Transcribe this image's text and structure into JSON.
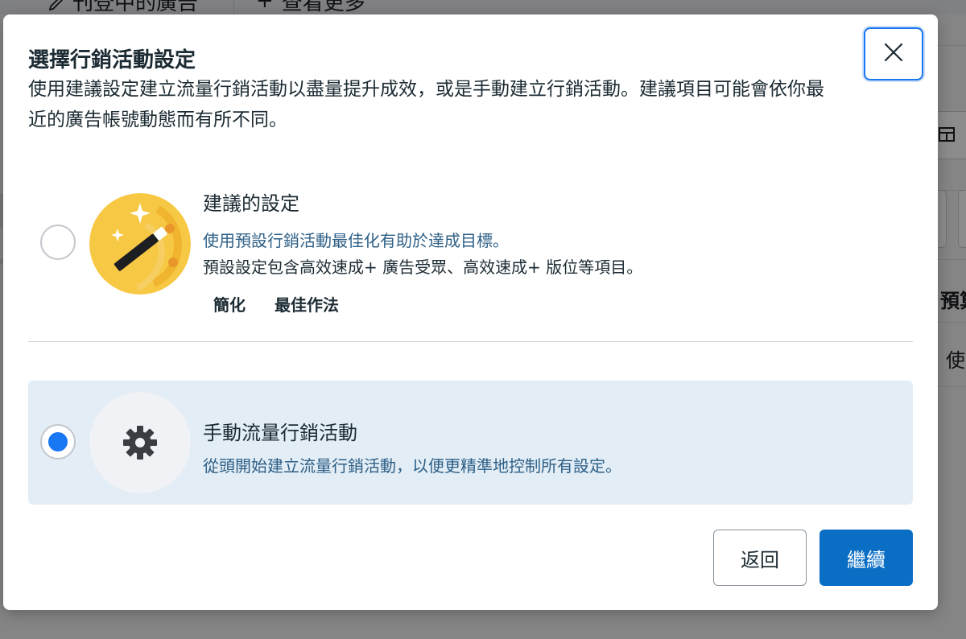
{
  "background": {
    "tab_one_label": "刊登中的廣告",
    "tab_two_label": "查看更多",
    "right_text_1": "預算",
    "right_text_2": "使"
  },
  "modal": {
    "title": "選擇行銷活動設定",
    "description": "使用建議設定建立流量行銷活動以盡量提升成效，或是手動建立行銷活動。建議項目可能會依你最近的廣告帳號動態而有所不同。",
    "close_icon": "close-icon",
    "options": {
      "recommended": {
        "title": "建議的設定",
        "line1": "使用預設行銷活動最佳化有助於達成目標。",
        "line2": "預設設定包含高效速成+ 廣告受眾、高效速成+ 版位等項目。",
        "tags": [
          "簡化",
          "最佳作法"
        ],
        "icon": "magic-wand-icon",
        "selected": false
      },
      "manual": {
        "title": "手動流量行銷活動",
        "line1": "從頭開始建立流量行銷活動，以便更精準地控制所有設定。",
        "icon": "gear-icon",
        "selected": true
      }
    },
    "buttons": {
      "back_label": "返回",
      "continue_label": "繼續"
    }
  },
  "colors": {
    "accent": "#1877f2",
    "primary_button": "#0a6ec4",
    "selected_option_bg": "#e2edf6",
    "wand_badge": "#f7c844"
  }
}
